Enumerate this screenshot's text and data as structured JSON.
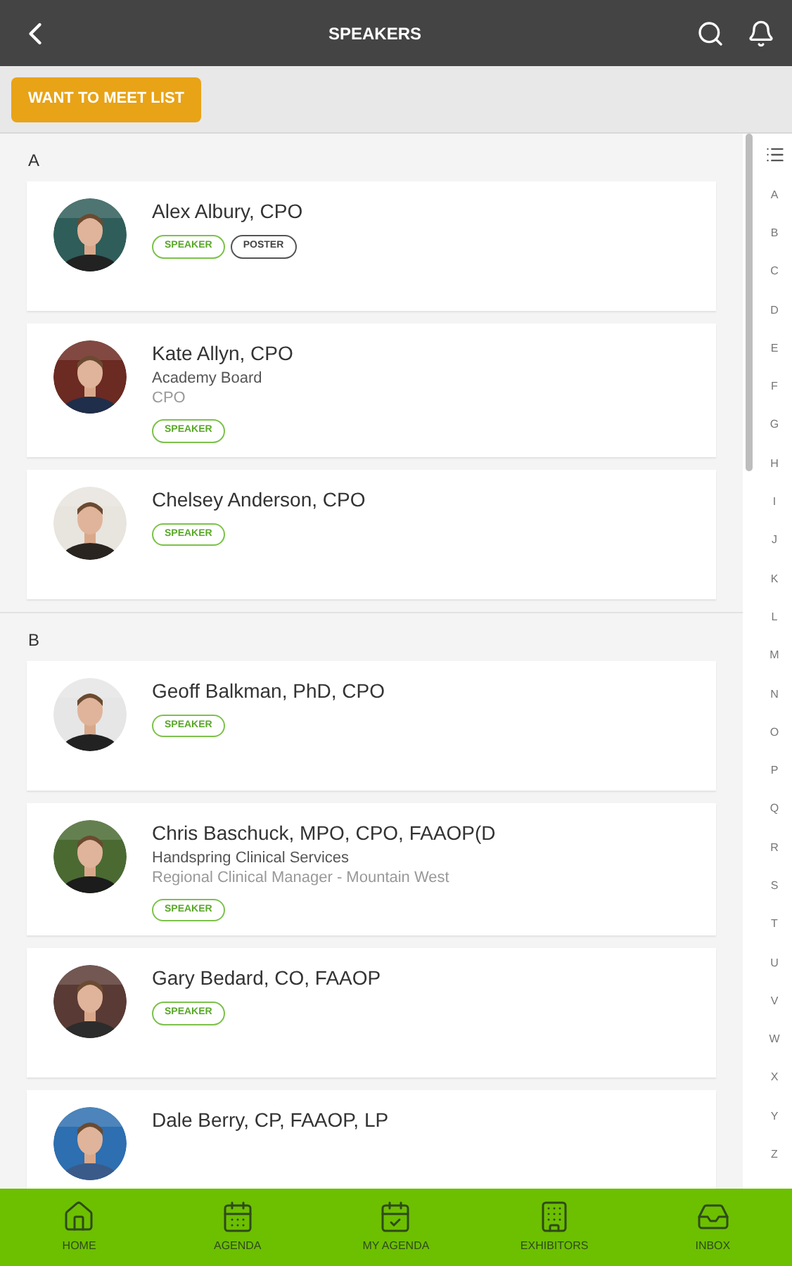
{
  "header": {
    "title": "SPEAKERS"
  },
  "toolbar": {
    "button": "WANT TO MEET LIST"
  },
  "sections": [
    {
      "letter": "A",
      "speakers": [
        {
          "name": "Alex Albury, CPO",
          "tags": [
            {
              "label": "SPEAKER",
              "kind": "speaker"
            },
            {
              "label": "POSTER",
              "kind": "poster"
            }
          ]
        },
        {
          "name": "Kate Allyn, CPO",
          "organization": "Academy Board",
          "position": "CPO",
          "tags": [
            {
              "label": "SPEAKER",
              "kind": "speaker"
            }
          ]
        },
        {
          "name": "Chelsey Anderson, CPO",
          "tags": [
            {
              "label": "SPEAKER",
              "kind": "speaker"
            }
          ]
        }
      ]
    },
    {
      "letter": "B",
      "speakers": [
        {
          "name": "Geoff Balkman, PhD, CPO",
          "tags": [
            {
              "label": "SPEAKER",
              "kind": "speaker"
            }
          ]
        },
        {
          "name": "Chris Baschuck, MPO, CPO, FAAOP(D",
          "organization": "Handspring Clinical Services",
          "position": "Regional Clinical Manager - Mountain West",
          "tags": [
            {
              "label": "SPEAKER",
              "kind": "speaker"
            }
          ]
        },
        {
          "name": "Gary Bedard, CO, FAAOP",
          "tags": [
            {
              "label": "SPEAKER",
              "kind": "speaker"
            }
          ]
        },
        {
          "name": "Dale Berry, CP, FAAOP, LP"
        }
      ]
    }
  ],
  "index": [
    "A",
    "B",
    "C",
    "D",
    "E",
    "F",
    "G",
    "H",
    "I",
    "J",
    "K",
    "L",
    "M",
    "N",
    "O",
    "P",
    "Q",
    "R",
    "S",
    "T",
    "U",
    "V",
    "W",
    "X",
    "Y",
    "Z"
  ],
  "nav": [
    {
      "label": "HOME"
    },
    {
      "label": "AGENDA"
    },
    {
      "label": "MY AGENDA"
    },
    {
      "label": "EXHIBITORS"
    },
    {
      "label": "INBOX"
    }
  ]
}
